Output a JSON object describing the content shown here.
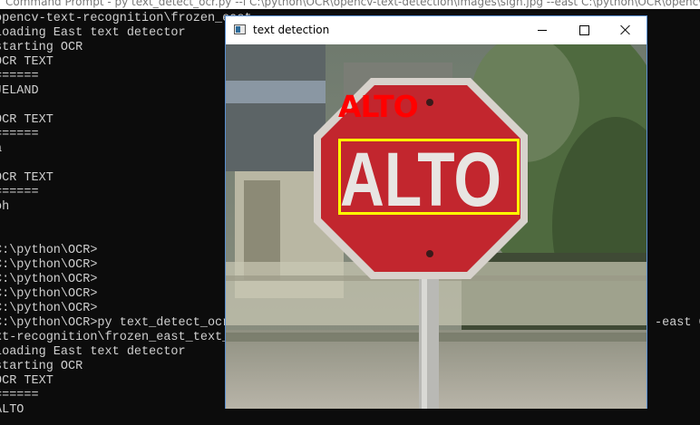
{
  "console": {
    "title": "Command Prompt - py text_detect_ocr.py --i C:\\python\\OCR\\opencv-text-detection\\images\\sign.jpg --east C:\\python\\OCR\\opencv-text-reco",
    "lines": [
      "opencv-text-recognition\\frozen_east",
      "Loading East text detector",
      "starting OCR",
      "OCR TEXT",
      "======",
      "JELAND",
      "",
      "OCR TEXT",
      "======",
      "a",
      "",
      "OCR TEXT",
      "======",
      "oh",
      "",
      "",
      "C:\\python\\OCR>",
      "C:\\python\\OCR>",
      "C:\\python\\OCR>",
      "C:\\python\\OCR>",
      "C:\\python\\OCR>",
      "C:\\python\\OCR>py text_detect_ocr",
      "xt-recognition\\frozen_east_text_",
      "Loading East text detector",
      "starting OCR",
      "OCR TEXT",
      "======",
      "ALTO"
    ],
    "right_fragment": "-east C"
  },
  "cv_window": {
    "title": "text detection",
    "buttons": {
      "minimize": "minimize",
      "maximize": "maximize",
      "close": "close"
    },
    "detected_label": "ALTO",
    "sign_text": "ALTO",
    "colors": {
      "label": "#ff0000",
      "box": "#ffff00",
      "sign": "#c2262e"
    }
  }
}
